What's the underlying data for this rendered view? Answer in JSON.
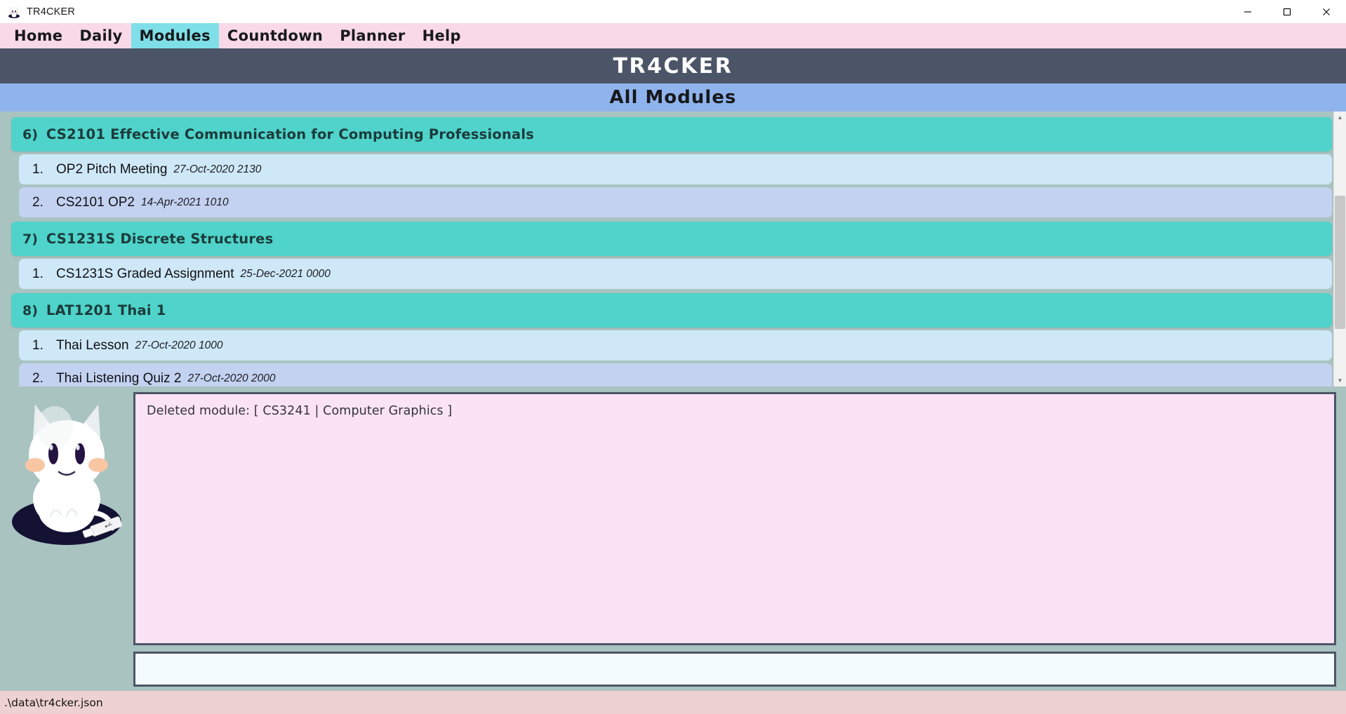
{
  "window": {
    "title": "TR4CKER",
    "icon": "cat-app-icon",
    "controls": {
      "minimize": "minimize-icon",
      "maximize": "maximize-icon",
      "close": "close-icon"
    }
  },
  "menubar": {
    "items": [
      {
        "label": "Home",
        "active": false
      },
      {
        "label": "Daily",
        "active": false
      },
      {
        "label": "Modules",
        "active": true
      },
      {
        "label": "Countdown",
        "active": false
      },
      {
        "label": "Planner",
        "active": false
      },
      {
        "label": "Help",
        "active": false
      }
    ],
    "active_bg": "#7fdfe8",
    "bg": "#f9d9e8"
  },
  "app_header": {
    "title": "TR4CKER",
    "bg": "#4c5567",
    "color": "#ffffff"
  },
  "page_header": {
    "title": "All Modules",
    "bg": "#8fb3ec",
    "color": "#17181b"
  },
  "modules": [
    {
      "index": "6)",
      "title": "CS2101 Effective Communication for Computing Professionals",
      "tasks": [
        {
          "index": "1.",
          "name": "OP2 Pitch Meeting",
          "date": "27-Oct-2020 2130"
        },
        {
          "index": "2.",
          "name": "CS2101 OP2",
          "date": "14-Apr-2021 1010"
        }
      ]
    },
    {
      "index": "7)",
      "title": "CS1231S Discrete Structures",
      "tasks": [
        {
          "index": "1.",
          "name": "CS1231S Graded Assignment",
          "date": "25-Dec-2021 0000"
        }
      ]
    },
    {
      "index": "8)",
      "title": "LAT1201 Thai 1",
      "tasks": [
        {
          "index": "1.",
          "name": "Thai Lesson",
          "date": "27-Oct-2020 1000"
        },
        {
          "index": "2.",
          "name": "Thai Listening Quiz 2",
          "date": "27-Oct-2020 2000"
        }
      ]
    }
  ],
  "console": {
    "output_lines": [
      "Deleted module: [ CS3241 | Computer Graphics ]"
    ],
    "input_value": "",
    "input_placeholder": ""
  },
  "statusbar": {
    "text": ".\\data\\tr4cker.json",
    "bg": "#eed1d1"
  },
  "mascot": {
    "name": "white-cat-mascot"
  },
  "colors": {
    "module_header": "#4fd3cb",
    "task_odd": "#cfe8f8",
    "task_even": "#c4d2f1",
    "background": "#a9c3c1",
    "console_border": "#4c5567",
    "output_bg": "#fae3f5",
    "input_bg": "#f4fbff"
  }
}
